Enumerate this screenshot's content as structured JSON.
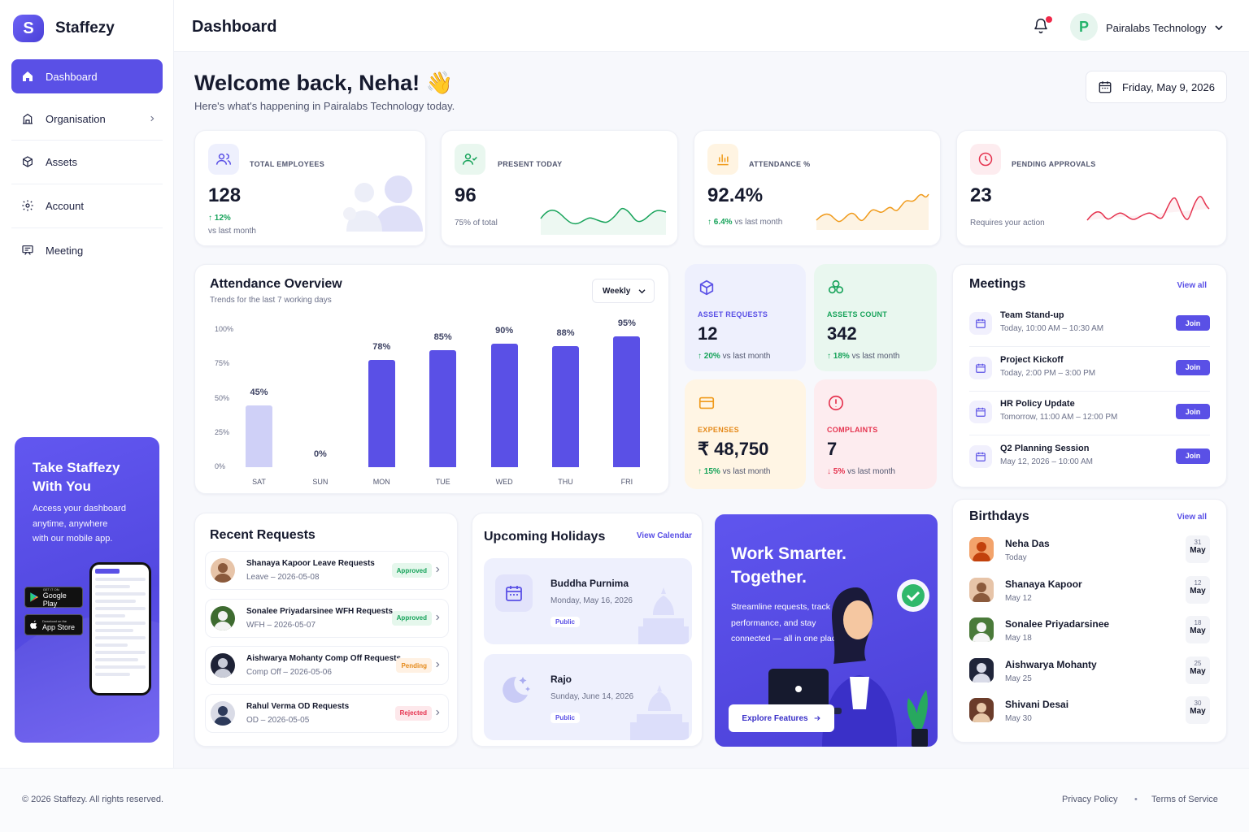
{
  "brand": {
    "name": "Staffezy",
    "mark": "S"
  },
  "sidebar": {
    "items": [
      {
        "label": "Dashboard",
        "icon": "home-icon",
        "active": true
      },
      {
        "label": "Organisation",
        "icon": "building-icon"
      },
      {
        "label": "Assets",
        "icon": "box-icon"
      },
      {
        "label": "Account",
        "icon": "gear-icon"
      },
      {
        "label": "Meeting",
        "icon": "presentation-icon"
      }
    ],
    "promo": {
      "title_line1": "Take Staffezy",
      "title_line2": "With You",
      "text_line1": "Access your dashboard",
      "text_line2": "anytime, anywhere",
      "text_line3": "with our mobile app.",
      "google_small": "GET IT ON",
      "google_label": "Google Play",
      "apple_small": "Download on the",
      "apple_label": "App Store"
    }
  },
  "topbar": {
    "title": "Dashboard",
    "org_name": "Pairalabs Technology",
    "org_mark": "P"
  },
  "welcome": {
    "heading": "Welcome back, Neha!",
    "emoji": "👋",
    "subtitle": "Here's what's happening in Pairalabs Technology today.",
    "date": "Friday, May 9, 2026"
  },
  "stats": {
    "employees": {
      "label": "TOTAL EMPLOYEES",
      "value": "128",
      "change": "12%",
      "note": "vs last month"
    },
    "present": {
      "label": "PRESENT TODAY",
      "value": "96",
      "note": "75% of total"
    },
    "attendance": {
      "label": "ATTENDANCE %",
      "value": "92.4%",
      "change": "6.4%",
      "note": "vs last month"
    },
    "approvals": {
      "label": "PENDING APPROVALS",
      "value": "23",
      "note": "Requires your action"
    }
  },
  "attendance_overview": {
    "title": "Attendance Overview",
    "subtitle": "Trends for the last 7 working days",
    "period": "Weekly"
  },
  "chart_data": {
    "type": "bar",
    "categories": [
      "SAT",
      "SUN",
      "MON",
      "TUE",
      "WED",
      "THU",
      "FRI"
    ],
    "values": [
      45,
      0,
      78,
      85,
      90,
      88,
      95
    ],
    "value_labels": [
      "45%",
      "0%",
      "78%",
      "85%",
      "90%",
      "88%",
      "95%"
    ],
    "yticks": [
      "100%",
      "75%",
      "50%",
      "25%",
      "0%"
    ],
    "ylim": [
      0,
      100
    ],
    "colors": {
      "bar": "#5a50e6",
      "bar_light": "#cfd0f7"
    }
  },
  "tiles": {
    "asset_requests": {
      "label": "ASSET REQUESTS",
      "value": "12",
      "change": "20%",
      "note": "vs last month"
    },
    "assets_count": {
      "label": "ASSETS COUNT",
      "value": "342",
      "change": "18%",
      "note": "vs last month"
    },
    "expenses": {
      "label": "EXPENSES",
      "value": "₹ 48,750",
      "change": "15%",
      "note": "vs last month"
    },
    "complaints": {
      "label": "COMPLAINTS",
      "value": "7",
      "change": "5%",
      "note": "vs last month"
    }
  },
  "meetings": {
    "title": "Meetings",
    "view_all": "View all",
    "join_label": "Join",
    "items": [
      {
        "title": "Team Stand-up",
        "time": "Today, 10:00 AM – 10:30 AM"
      },
      {
        "title": "Project Kickoff",
        "time": "Today, 2:00 PM – 3:00 PM"
      },
      {
        "title": "HR Policy Update",
        "time": "Tomorrow, 11:00 AM – 12:00 PM"
      },
      {
        "title": "Q2 Planning Session",
        "time": "May 12, 2026 – 10:00 AM"
      }
    ]
  },
  "birthdays": {
    "title": "Birthdays",
    "view_all": "View all",
    "items": [
      {
        "name": "Neha Das",
        "date": "Today",
        "day": "31",
        "month": "May"
      },
      {
        "name": "Shanaya Kapoor",
        "date": "May 12",
        "day": "12",
        "month": "May"
      },
      {
        "name": "Sonalee Priyadarsinee",
        "date": "May 18",
        "day": "18",
        "month": "May"
      },
      {
        "name": "Aishwarya Mohanty",
        "date": "May 25",
        "day": "25",
        "month": "May"
      },
      {
        "name": "Shivani Desai",
        "date": "May 30",
        "day": "30",
        "month": "May"
      }
    ]
  },
  "requests": {
    "title": "Recent Requests",
    "items": [
      {
        "title": "Shanaya Kapoor Leave Requests",
        "sub": "Leave – 2026-05-08",
        "status": "Approved"
      },
      {
        "title": "Sonalee Priyadarsinee WFH Requests",
        "sub": "WFH – 2026-05-07",
        "status": "Approved"
      },
      {
        "title": "Aishwarya Mohanty Comp Off Requests",
        "sub": "Comp Off – 2026-05-06",
        "status": "Pending"
      },
      {
        "title": "Rahul Verma OD Requests",
        "sub": "OD – 2026-05-05",
        "status": "Rejected"
      }
    ]
  },
  "holidays": {
    "title": "Upcoming Holidays",
    "view_calendar": "View Calendar",
    "items": [
      {
        "name": "Buddha Purnima",
        "date": "Monday, May 16, 2026",
        "tag": "Public"
      },
      {
        "name": "Rajo",
        "date": "Sunday, June 14, 2026",
        "tag": "Public"
      }
    ]
  },
  "work_smarter": {
    "title_line1": "Work Smarter.",
    "title_line2": "Together.",
    "text_line1": "Streamline requests, track",
    "text_line2": "performance, and stay",
    "text_line3": "connected — all in one place.",
    "button": "Explore Features"
  },
  "footer": {
    "copyright": "© 2026 Staffezy. All rights reserved.",
    "privacy": "Privacy Policy",
    "dot": "•",
    "terms": "Terms of Service"
  }
}
